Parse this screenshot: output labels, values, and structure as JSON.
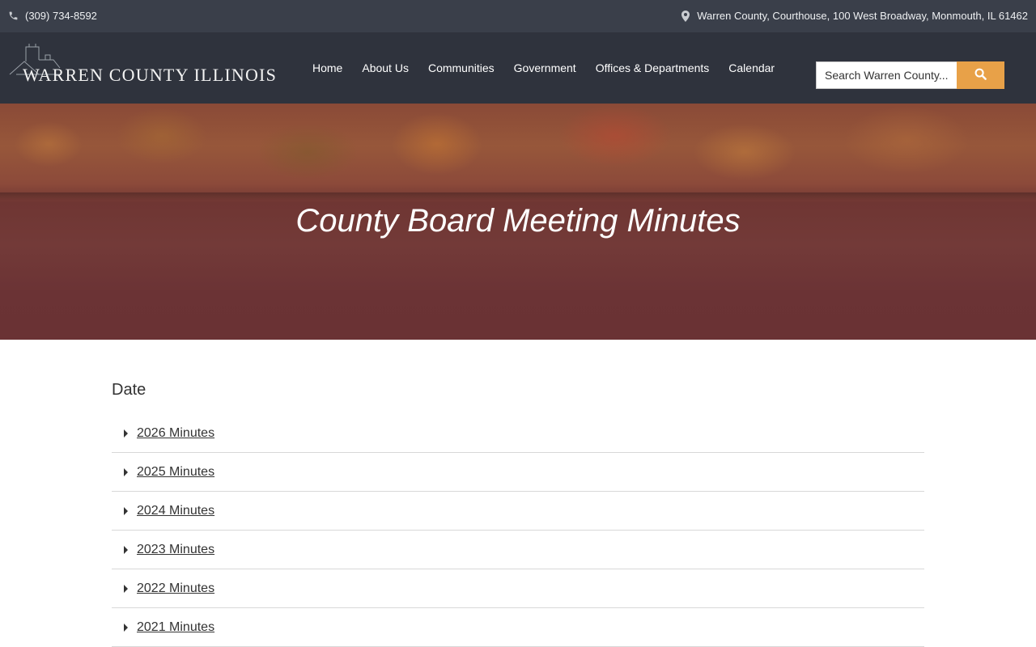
{
  "topbar": {
    "phone": "(309) 734-8592",
    "address": "Warren County, Courthouse, 100 West Broadway, Monmouth, IL 61462"
  },
  "header": {
    "logo_text": "WARREN COUNTY ILLINOIS",
    "nav": [
      "Home",
      "About Us",
      "Communities",
      "Government",
      "Offices & Departments",
      "Calendar"
    ],
    "search_placeholder": "Search Warren County..."
  },
  "hero": {
    "title": "County Board Meeting Minutes"
  },
  "main": {
    "date_heading": "Date",
    "years": [
      "2026 Minutes",
      "2025 Minutes",
      "2024 Minutes",
      "2023 Minutes",
      "2022 Minutes",
      "2021 Minutes"
    ]
  },
  "colors": {
    "topbar_bg": "#3a3f4a",
    "navbar_bg": "#2f333d",
    "accent": "#e8a148"
  },
  "icons": {
    "phone": "phone-icon",
    "location": "map-pin-icon",
    "search": "search-icon",
    "caret": "caret-right-icon"
  }
}
